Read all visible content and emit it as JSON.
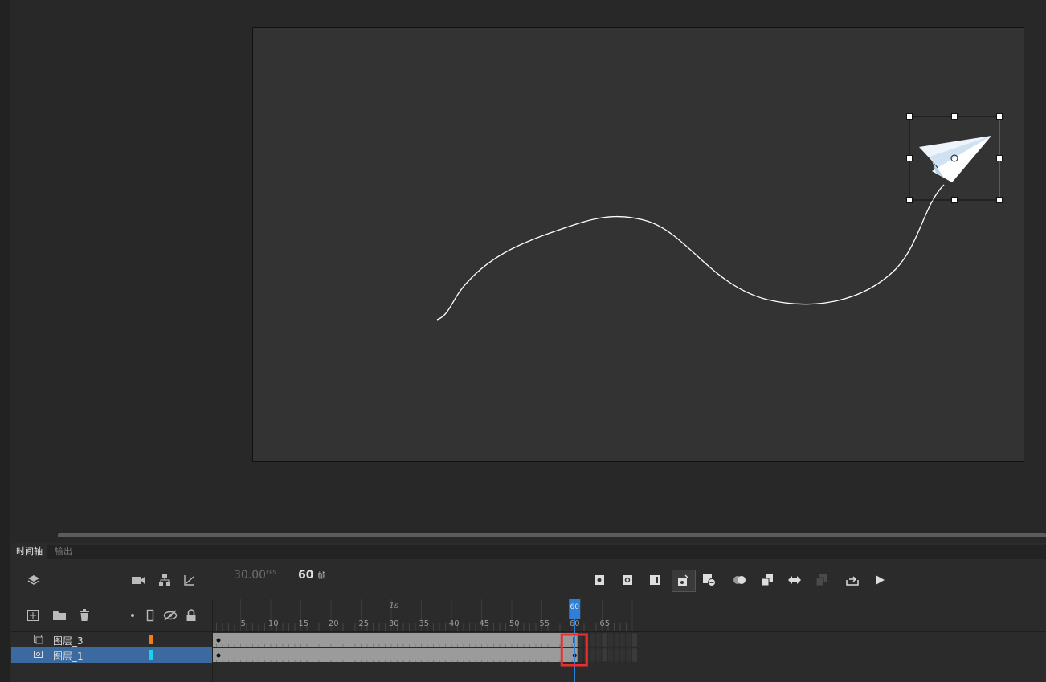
{
  "tabs": {
    "timeline": "时间轴",
    "output": "输出"
  },
  "timeline": {
    "fps_value": "30.00",
    "fps_unit": "FPS",
    "frame_count": "60",
    "frame_unit": "帧",
    "ruler_second_label": "1s",
    "ruler_labels": [
      "5",
      "10",
      "15",
      "20",
      "25",
      "30",
      "35",
      "40",
      "45",
      "50",
      "55",
      "60",
      "65"
    ],
    "current_frame": "60"
  },
  "layers": [
    {
      "name": "图层_3",
      "color": "#f07d1c",
      "selected": false
    },
    {
      "name": "图层_1",
      "color": "#19d0f0",
      "selected": true
    }
  ],
  "colors": {
    "selection_row": "#3b6aa0",
    "playhead": "#2f7fd6",
    "highlight_box": "#e83030"
  }
}
